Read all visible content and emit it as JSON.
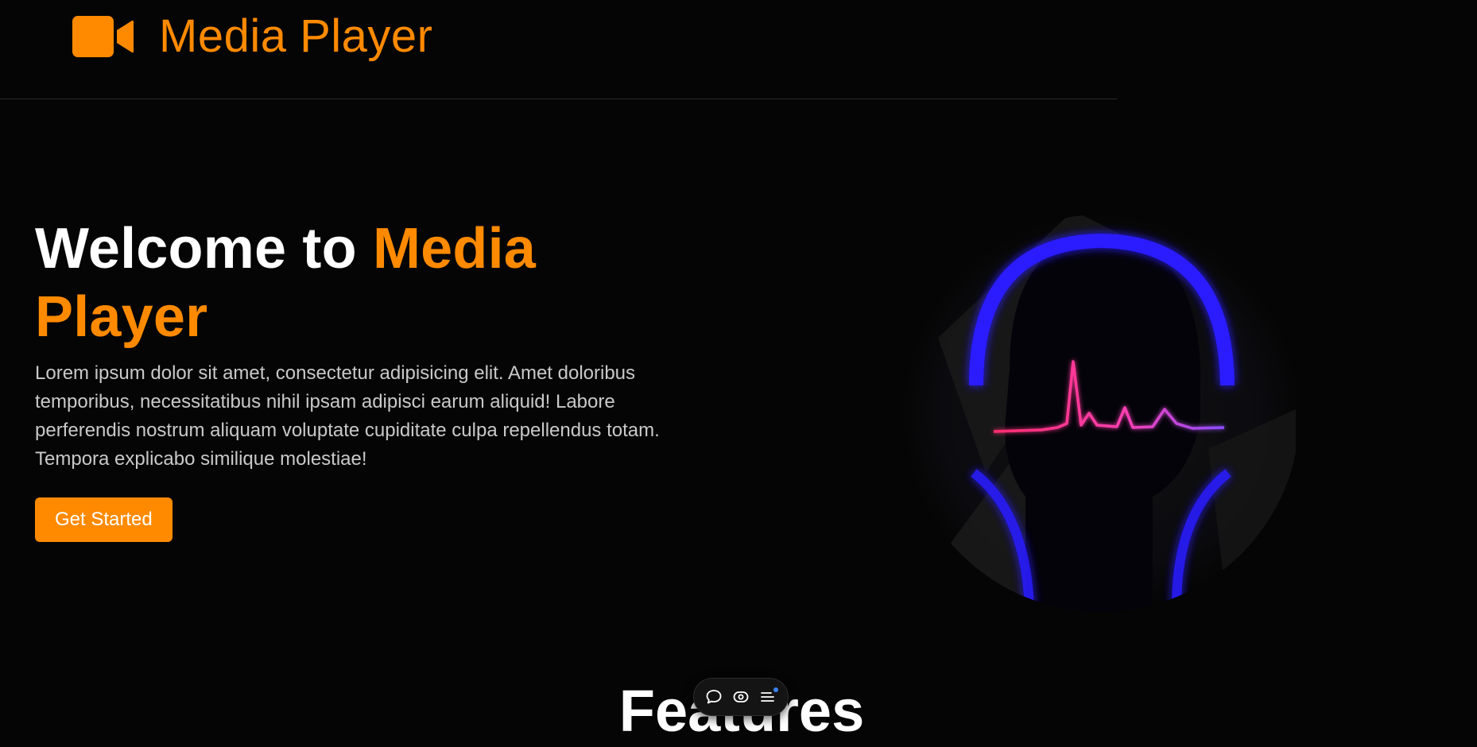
{
  "header": {
    "brand_name": "Media Player",
    "brand_icon": "video-camera-icon"
  },
  "hero": {
    "title_prefix": "Welcome to",
    "title_accent": "Media Player",
    "description": "Lorem ipsum dolor sit amet, consectetur adipisicing elit. Amet doloribus temporibus, necessitatibus nihil ipsam adipisci earum aliquid! Labore perferendis nostrum aliquam voluptate cupiditate culpa repellendus totam. Tempora explicabo similique molestiae!",
    "cta_label": "Get Started",
    "illustration": "headphones-waveform-illustration"
  },
  "features": {
    "title": "Features"
  },
  "floating_toolbar": {
    "items": [
      "comment-icon",
      "eye-icon",
      "menu-list-icon"
    ]
  },
  "colors": {
    "accent": "#ff8a00",
    "background": "#050505",
    "text": "#ffffff",
    "muted_text": "#c9c9c9"
  }
}
